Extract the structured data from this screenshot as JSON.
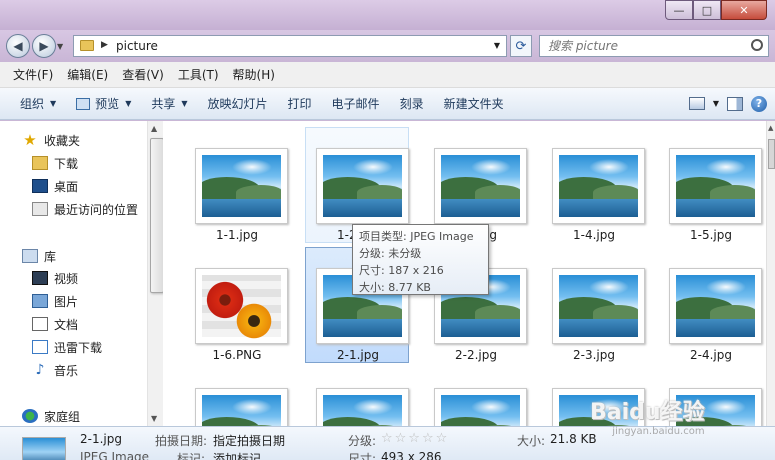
{
  "window": {
    "title": "",
    "controls": {
      "minimize": "—",
      "maximize": "□",
      "close": "✕"
    }
  },
  "address": {
    "path": "picture",
    "back_glyph": "◀",
    "forward_glyph": "▶",
    "refresh_glyph": "⟳"
  },
  "search": {
    "placeholder": "搜索 picture"
  },
  "menubar": [
    "文件(F)",
    "编辑(E)",
    "查看(V)",
    "工具(T)",
    "帮助(H)"
  ],
  "toolbar": {
    "organize": "组织",
    "preview": "预览",
    "share": "共享",
    "slideshow": "放映幻灯片",
    "print": "打印",
    "email": "电子邮件",
    "burn": "刻录",
    "new_folder": "新建文件夹",
    "help": "?"
  },
  "sidebar": {
    "favorites": {
      "title": "收藏夹",
      "items": [
        "下载",
        "桌面",
        "最近访问的位置"
      ]
    },
    "libraries": {
      "title": "库",
      "items": [
        "视频",
        "图片",
        "文档",
        "迅雷下载",
        "音乐"
      ]
    },
    "homegroup": "家庭组"
  },
  "files": [
    {
      "name": "1-1.jpg",
      "kind": "landscape",
      "state": "normal"
    },
    {
      "name": "1-2.jpg",
      "kind": "landscape",
      "state": "hover"
    },
    {
      "name": "1-3.jpg",
      "kind": "landscape",
      "state": "normal"
    },
    {
      "name": "1-4.jpg",
      "kind": "landscape",
      "state": "normal"
    },
    {
      "name": "1-5.jpg",
      "kind": "landscape",
      "state": "normal"
    },
    {
      "name": "1-6.PNG",
      "kind": "flowers",
      "state": "normal"
    },
    {
      "name": "2-1.jpg",
      "kind": "landscape",
      "state": "selected"
    },
    {
      "name": "2-2.jpg",
      "kind": "landscape",
      "state": "normal"
    },
    {
      "name": "2-3.jpg",
      "kind": "landscape",
      "state": "normal"
    },
    {
      "name": "2-4.jpg",
      "kind": "landscape",
      "state": "normal"
    },
    {
      "name": "",
      "kind": "landscape",
      "state": "normal"
    },
    {
      "name": "",
      "kind": "landscape",
      "state": "normal"
    },
    {
      "name": "",
      "kind": "landscape",
      "state": "normal"
    },
    {
      "name": "",
      "kind": "landscape",
      "state": "normal"
    },
    {
      "name": "",
      "kind": "landscape",
      "state": "normal"
    }
  ],
  "tooltip": {
    "type": "项目类型: JPEG Image",
    "rating": "分级: 未分级",
    "dimensions": "尺寸: 187 x 216",
    "size": "大小: 8.77 KB"
  },
  "details": {
    "filename": "2-1.jpg",
    "filetype": "JPEG Image",
    "date_taken_label": "拍摄日期:",
    "date_taken_value": "指定拍摄日期",
    "tags_label": "标记:",
    "tags_value": "添加标记",
    "rating_label": "分级:",
    "rating_stars": "☆☆☆☆☆",
    "dims_label": "尺寸:",
    "dims_value": "493 x 286",
    "size_label": "大小:",
    "size_value": "21.8 KB"
  },
  "watermark": {
    "text": "Baidu经验",
    "sub": "jingyan.baidu.com"
  }
}
